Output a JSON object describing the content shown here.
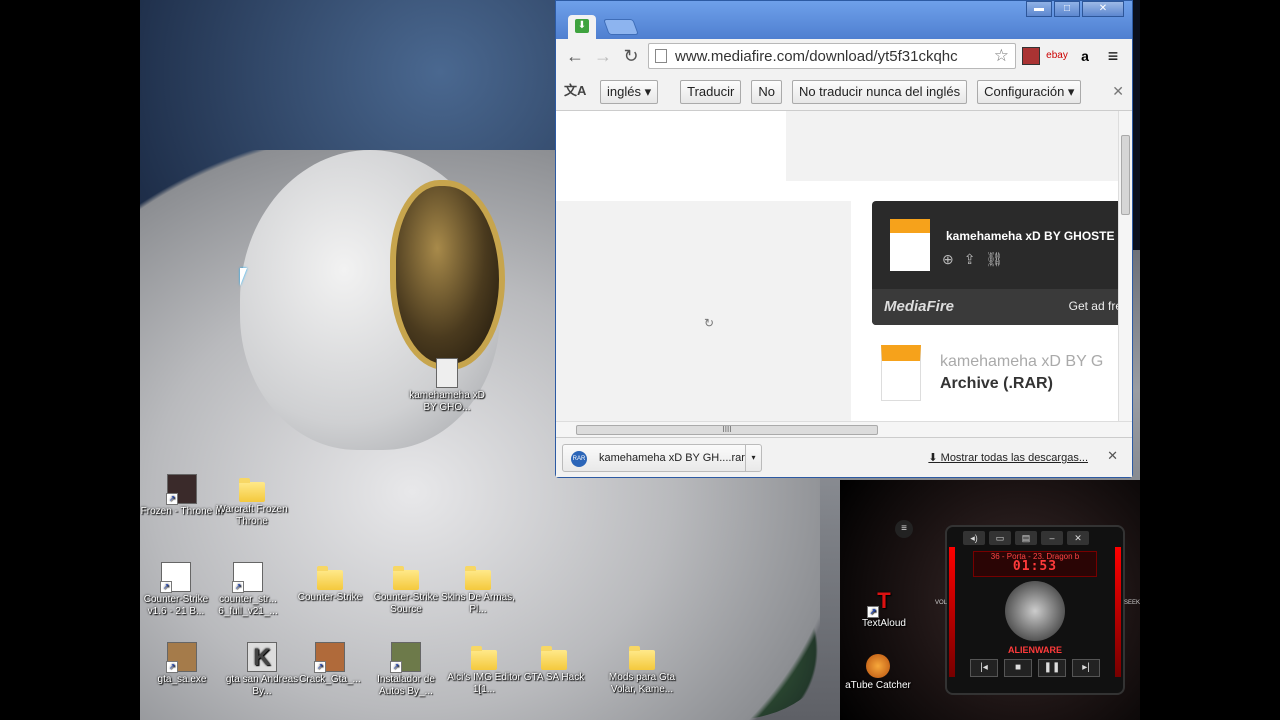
{
  "desktop": {
    "icons": [
      {
        "label": "Frozen - Throne III",
        "type": "app"
      },
      {
        "label": "Warcraft Frozen Throne",
        "type": "folder"
      },
      {
        "label": "kamehameha xD BY GHO...",
        "type": "file"
      },
      {
        "label": "Counter-Strike v1.6 - 21 B...",
        "type": "app"
      },
      {
        "label": "counter_str... 6_full_v21_...",
        "type": "app"
      },
      {
        "label": "Counter-Strike",
        "type": "folder"
      },
      {
        "label": "Counter-Strike Source",
        "type": "folder"
      },
      {
        "label": "Skins De Armas, Pl...",
        "type": "folder"
      },
      {
        "label": "gta_sa.exe",
        "type": "app"
      },
      {
        "label": "gta san Andreas By...",
        "type": "app"
      },
      {
        "label": "Crack_Gta_...",
        "type": "app"
      },
      {
        "label": "Instalador de Autos By_...",
        "type": "app"
      },
      {
        "label": "Alci's IMG Editor 1[1...",
        "type": "folder"
      },
      {
        "label": "GTA SA Hack",
        "type": "folder"
      },
      {
        "label": "Mods para Gta Volar, Kame...",
        "type": "folder"
      },
      {
        "label": "TextAloud",
        "type": "app"
      },
      {
        "label": "aTube Catcher",
        "type": "app"
      }
    ]
  },
  "browser": {
    "window_buttons": {
      "minimize": "▬",
      "maximize": "□",
      "close": "✕"
    },
    "url": "www.mediafire.com/download/yt5f31ckqhc",
    "extensions": {
      "ebay": "ebay",
      "amazon": "a",
      "menu": "≡"
    },
    "translate": {
      "icon": "文A",
      "language": "inglés",
      "translate_btn": "Traducir",
      "no_btn": "No",
      "never_btn": "No traducir nunca del inglés",
      "settings_btn": "Configuración"
    },
    "page": {
      "card_file_name": "kamehameha xD BY GHOSTE",
      "card_logo": "MediaFire",
      "card_ad": "Get ad fre",
      "file_name": "kamehameha xD BY G",
      "file_type": "Archive (.RAR)"
    },
    "scroll_thumb_mark": "IIII",
    "downloads": {
      "item_label": "kamehameha xD BY GH....rar",
      "item_icon": "RAR",
      "show_all": "Mostrar todas las descargas..."
    }
  },
  "player": {
    "track": "36 - Porta - 23. Dragon b",
    "time": "01:53",
    "brand": "ALIENWARE",
    "side_left": "VOL",
    "side_right": "SEEK"
  }
}
